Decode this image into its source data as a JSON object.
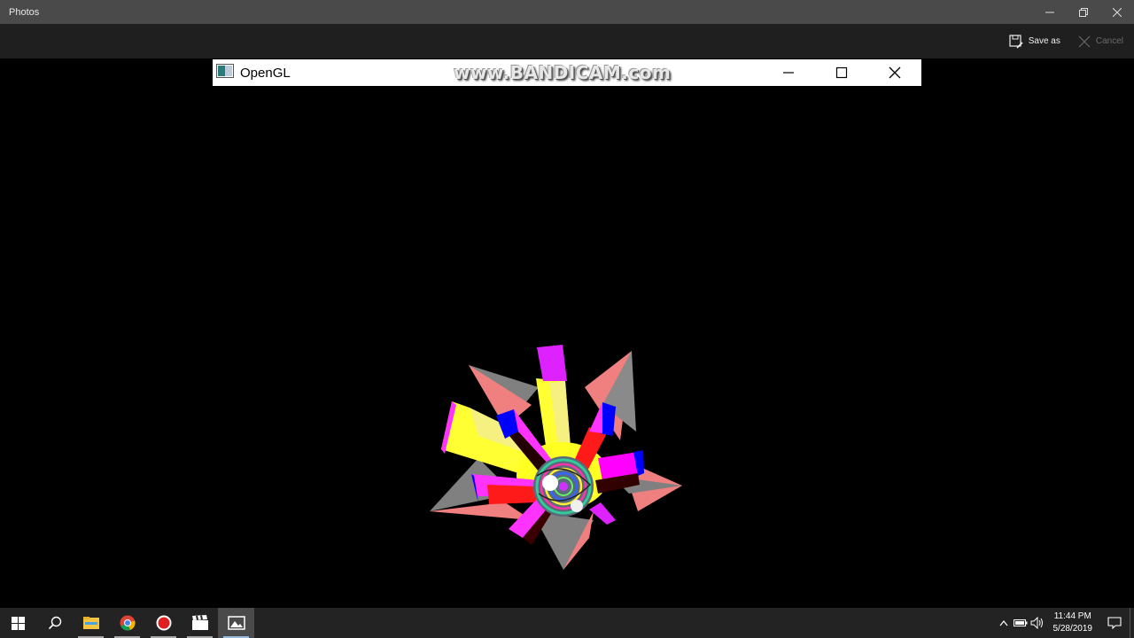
{
  "window": {
    "title": "Photos"
  },
  "commands": {
    "save_as": "Save as",
    "cancel": "Cancel"
  },
  "opengl_window": {
    "title": "OpenGL",
    "watermark": "www.BANDICAM.com"
  },
  "taskbar": {
    "items": [
      {
        "icon": "windows-start-icon"
      },
      {
        "icon": "search-icon"
      },
      {
        "icon": "file-explorer-icon"
      },
      {
        "icon": "chrome-icon"
      },
      {
        "icon": "record-icon"
      },
      {
        "icon": "clapperboard-icon"
      },
      {
        "icon": "photos-icon"
      }
    ],
    "time": "11:44 PM",
    "date": "5/28/2019"
  },
  "colors": {
    "titlebar": "#4a4a4a",
    "commandbar": "#1f1f1f",
    "taskbar": "#232323",
    "scene_yellow": "#ffff33",
    "scene_magenta": "#ff00ff",
    "scene_red": "#ff1a1a",
    "scene_blue": "#0000ff",
    "scene_salmon": "#f08080",
    "scene_gray": "#808080"
  }
}
